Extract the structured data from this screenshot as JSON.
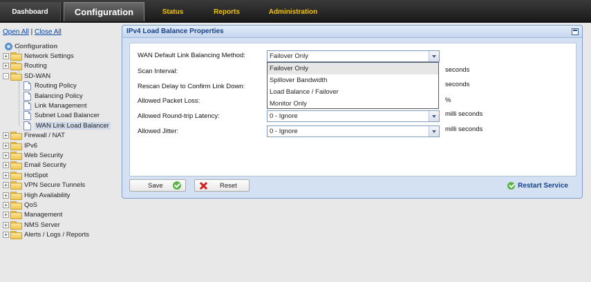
{
  "nav": {
    "dashboard": "Dashboard",
    "configuration": "Configuration",
    "status": "Status",
    "reports": "Reports",
    "administration": "Administration"
  },
  "tree": {
    "open_all": "Open All",
    "separator": "|",
    "close_all": "Close All",
    "root": "Configuration",
    "items": [
      {
        "label": "Network Settings",
        "expander": "+"
      },
      {
        "label": "Routing",
        "expander": "+"
      },
      {
        "label": "SD-WAN",
        "expander": "-"
      },
      {
        "label": "Routing Policy"
      },
      {
        "label": "Balancing Policy"
      },
      {
        "label": "Link Management"
      },
      {
        "label": "Subnet Load Balancer"
      },
      {
        "label": "WAN Link Load Balancer"
      },
      {
        "label": "Firewall / NAT",
        "expander": "+"
      },
      {
        "label": "IPv6",
        "expander": "+"
      },
      {
        "label": "Web Security",
        "expander": "+"
      },
      {
        "label": "Email Security",
        "expander": "+"
      },
      {
        "label": "HotSpot",
        "expander": "+"
      },
      {
        "label": "VPN Secure Tunnels",
        "expander": "+"
      },
      {
        "label": "High Availability",
        "expander": "+"
      },
      {
        "label": "QoS",
        "expander": "+"
      },
      {
        "label": "Management",
        "expander": "+"
      },
      {
        "label": "NMS Server",
        "expander": "+"
      },
      {
        "label": "Alerts / Logs / Reports",
        "expander": "+"
      }
    ]
  },
  "panel": {
    "title": "IPv4 Load Balance Properties",
    "fields": {
      "method": {
        "label": "WAN Default Link Balancing Method:",
        "value": "Failover Only"
      },
      "scan": {
        "label": "Scan Interval:",
        "unit": "seconds"
      },
      "rescan": {
        "label": "Rescan Delay to Confirm Link Down:",
        "unit": "seconds"
      },
      "loss": {
        "label": "Allowed Packet Loss:",
        "unit": "%"
      },
      "latency": {
        "label": "Allowed Round-trip Latency:",
        "value": "0 - Ignore",
        "unit": "milli seconds"
      },
      "jitter": {
        "label": "Allowed Jitter:",
        "value": "0 - Ignore",
        "unit": "milli seconds"
      }
    },
    "dropdown_options": [
      "Failover Only",
      "Spillover Bandwidth",
      "Load Balance / Failover",
      "Monitor Only"
    ],
    "save": "Save",
    "reset": "Reset",
    "restart": "Restart Service"
  }
}
